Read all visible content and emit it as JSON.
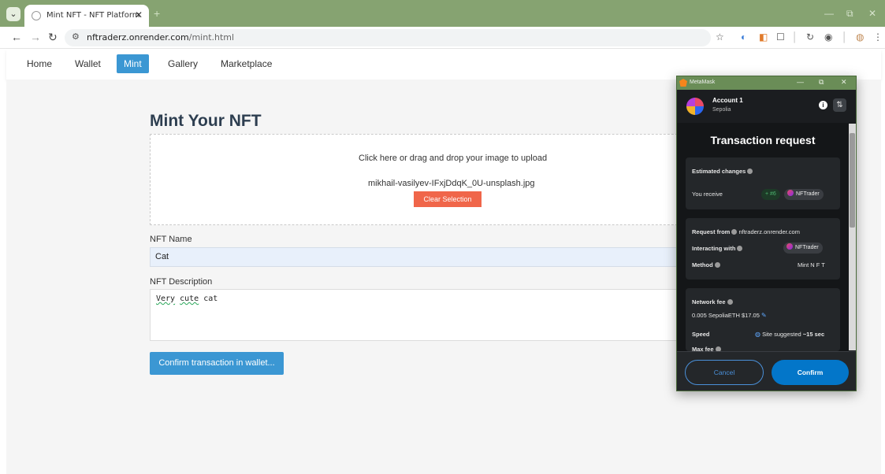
{
  "browser": {
    "tab_menu_glyph": "⌄",
    "tab_title": "Mint NFT - NFT Platform",
    "tab_close": "✕",
    "new_tab": "+",
    "window": {
      "minimize": "—",
      "restore": "⧉",
      "close": "✕"
    },
    "nav": {
      "back": "←",
      "forward": "→",
      "reload": "↻"
    },
    "url_host": "nftraderz.onrender.com",
    "url_path": "/mint.html",
    "url_tune_glyph": "⚙",
    "bookmark_glyph": "☆",
    "extension_glyphs": [
      "◐",
      "◧",
      "☐",
      "│",
      "↻",
      "◉",
      "│",
      "◍",
      "⋮"
    ]
  },
  "nav": {
    "items": [
      "Home",
      "Wallet",
      "Mint",
      "Gallery",
      "Marketplace"
    ],
    "active": "Mint"
  },
  "mint": {
    "title": "Mint Your NFT",
    "dropzone_prompt": "Click here or drag and drop your image to upload",
    "file_name": "mikhail-vasilyev-IFxjDdqK_0U-unsplash.jpg",
    "clear_button": "Clear Selection",
    "name_label": "NFT Name",
    "name_value": "Cat",
    "desc_label": "NFT Description",
    "desc_word1": "Very",
    "desc_word2": "cute",
    "desc_word3": "cat",
    "confirm_button": "Confirm transaction in wallet..."
  },
  "metamask": {
    "window_title": "MetaMask",
    "account": "Account 1",
    "network": "Sepolia",
    "info_glyph": "i",
    "settings_glyph": "⇅",
    "heading": "Transaction request",
    "estimated_changes": "Estimated changes",
    "you_receive": "You receive",
    "receive_amount": "+ #6",
    "token_name": "NFTrader",
    "request_from_label": "Request from",
    "request_from_value": "nftraderz.onrender.com",
    "interacting_with_label": "Interacting with",
    "interacting_with_value": "NFTrader",
    "method_label": "Method",
    "method_value": "Mint N F T",
    "network_fee_label": "Network fee",
    "network_fee_value": "0.005 SepoliaETH $17.05",
    "speed_label": "Speed",
    "speed_value": "Site suggested",
    "speed_time": "~15 sec",
    "max_fee_label": "Max fee",
    "cancel_button": "Cancel",
    "confirm_button": "Confirm",
    "accent_color": "#0376c9"
  }
}
